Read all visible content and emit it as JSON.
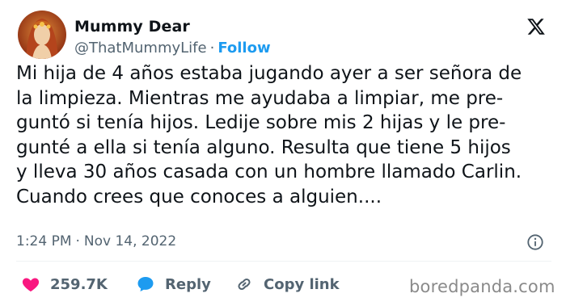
{
  "author": {
    "display_name": "Mummy Dear",
    "handle": "@ThatMummyLife",
    "separator": "·",
    "follow_label": "Follow"
  },
  "tweet": {
    "text": "Mi hija de 4 años estaba jugando ayer a ser señora de\nla limpieza. Mientras me ayudaba a limpiar, me pre-\nguntó si tenía hijos. Ledije sobre mis 2 hijas y le pre-\ngunté a ella si tenía alguno. Resulta que tiene 5 hijos\ny lleva 30 años casada con un hombre llamado Carlin.\nCuando crees que conoces a alguien....",
    "time": "1:24 PM",
    "separator": "·",
    "date": "Nov 14, 2022"
  },
  "actions": {
    "likes": "259.7K",
    "reply_label": "Reply",
    "copy_link_label": "Copy link"
  },
  "watermark": "boredpanda.com",
  "icons": {
    "platform": "x-logo-icon",
    "info": "info-icon",
    "like": "heart-icon",
    "reply": "reply-bubble-icon",
    "copy": "link-icon"
  },
  "colors": {
    "accent": "#1d9bf0",
    "like": "#f91880",
    "text": "#0f1419",
    "secondary": "#536471"
  }
}
